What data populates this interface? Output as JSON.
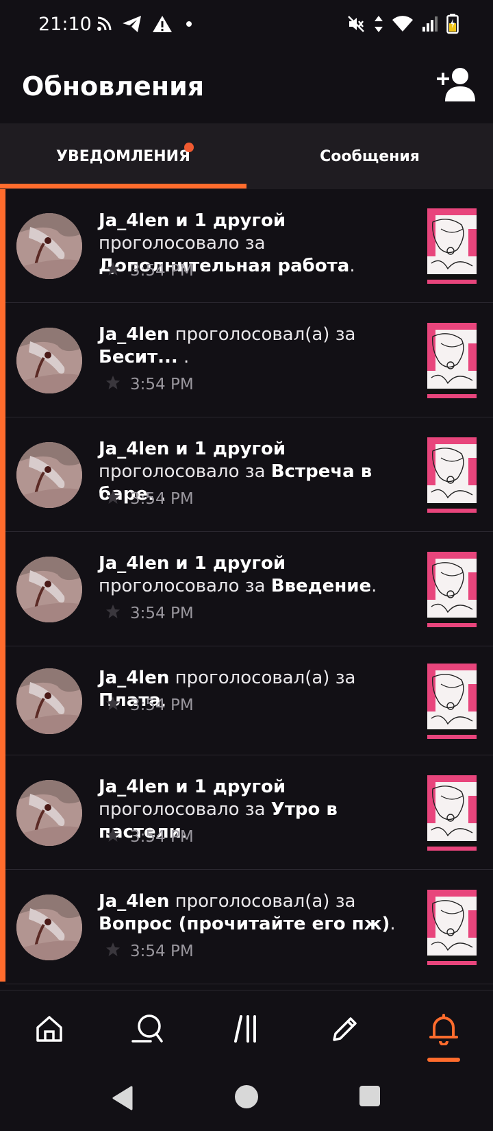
{
  "status_bar": {
    "time": "21:10",
    "left_icons": [
      "rss-icon",
      "telegram-icon",
      "warning-icon",
      "dot-icon"
    ],
    "right_icons": [
      "mute-icon",
      "data-arrows-icon",
      "wifi-icon",
      "signal-icon",
      "battery-icon"
    ]
  },
  "header": {
    "title": "Обновления",
    "add_user_icon": "add-user-icon"
  },
  "tabs": [
    {
      "label": "УВЕДОМЛЕНИЯ",
      "active": true,
      "has_badge": true
    },
    {
      "label": "Сообщения",
      "active": false
    }
  ],
  "notifications": [
    {
      "actor": "Ja_4len и 1 другой",
      "action": " проголосовало за ",
      "target": "Дополнительная работа",
      "suffix": ".",
      "time": "3:54 PM"
    },
    {
      "actor": "Ja_4len",
      "action": " проголосовал(а) за ",
      "target": "Бесит...",
      "suffix": " .",
      "time": "3:54 PM"
    },
    {
      "actor": "Ja_4len и 1 другой",
      "action": " проголосовало за ",
      "target": "Встреча в баре.",
      "suffix": " .",
      "time": "3:54 PM"
    },
    {
      "actor": "Ja_4len и 1 другой",
      "action": " проголосовало за ",
      "target": "Введение",
      "suffix": ".",
      "time": "3:54 PM"
    },
    {
      "actor": "Ja_4len",
      "action": " проголосовал(а) за ",
      "target": "Плата",
      "suffix": ".",
      "time": "3:54 PM"
    },
    {
      "actor": "Ja_4len и 1 другой",
      "action": " проголосовало за ",
      "target": "Утро в пастели",
      "suffix": ".",
      "time": "3:54 PM"
    },
    {
      "actor": "Ja_4len",
      "action": " проголосовал(а) за ",
      "target": "Вопрос (прочитайте его пж)",
      "suffix": ".",
      "time": "3:54 PM"
    }
  ],
  "bottom_nav": [
    {
      "icon": "home-icon",
      "active": false
    },
    {
      "icon": "search-icon",
      "active": false
    },
    {
      "icon": "library-icon",
      "active": false
    },
    {
      "icon": "write-icon",
      "active": false
    },
    {
      "icon": "bell-icon",
      "active": true
    }
  ],
  "system_nav": [
    "back-icon",
    "home-circle-icon",
    "recents-icon"
  ],
  "colors": {
    "accent": "#ff6c2d",
    "background": "#121015",
    "tab_bar": "#1f1c21",
    "badge": "#f05a31",
    "muted_text": "#9a979e"
  }
}
